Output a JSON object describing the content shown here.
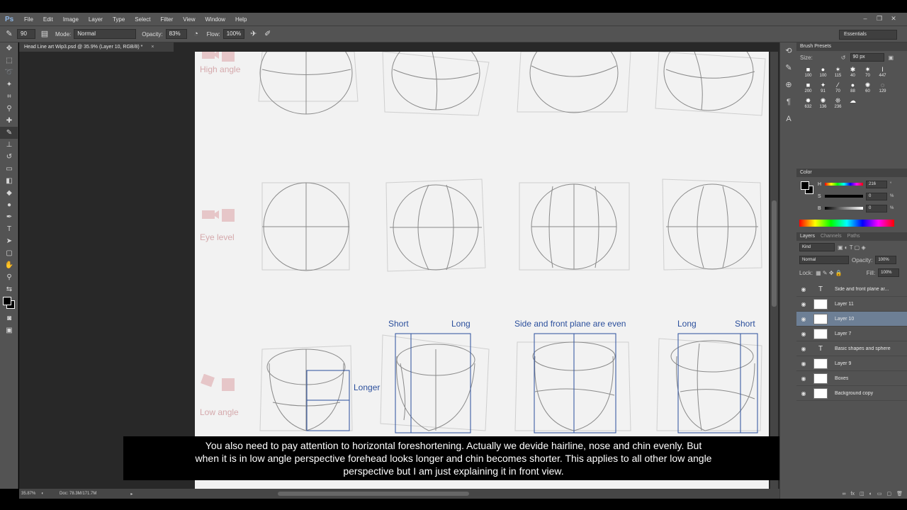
{
  "menubar": {
    "logo": "Ps",
    "items": [
      "File",
      "Edit",
      "Image",
      "Layer",
      "Type",
      "Select",
      "Filter",
      "View",
      "Window",
      "Help"
    ],
    "window_controls": [
      "–",
      "❐",
      "✕"
    ]
  },
  "options": {
    "brush_size": "90",
    "mode_label": "Mode:",
    "mode_value": "Normal",
    "opacity_label": "Opacity:",
    "opacity_value": "83%",
    "flow_label": "Flow:",
    "flow_value": "100%",
    "workspace": "Essentials"
  },
  "document": {
    "tab_title": "Head Line art Wip3.psd @ 35.9% (Layer 10, RGB/8) *",
    "close": "×"
  },
  "canvas": {
    "angles": {
      "high": "High angle",
      "eye": "Eye level",
      "low": "Low angle"
    },
    "annotations": {
      "short1": "Short",
      "long1": "Long",
      "even": "Side and front plane are even",
      "long2": "Long",
      "short2": "Short",
      "longer": "Longer"
    }
  },
  "caption": {
    "line1": "You also need to pay attention to horizontal foreshortening. Actually we devide hairline, nose and chin evenly. But",
    "line2": "when it is in low angle perspective forehead looks longer and chin becomes shorter. This applies to all other low angle",
    "line3": "perspective but I am just explaining it in front view."
  },
  "status": {
    "zoom": "35.87%",
    "doc": "Doc: 78.3M/171.7M"
  },
  "brush_panel": {
    "title": "Brush Presets",
    "size_label": "Size:",
    "size_value": "90 px",
    "presets": [
      "100",
      "100",
      "115",
      "40",
      "70",
      "447",
      "200",
      "91",
      "70",
      "88",
      "60",
      "129",
      "632",
      "136",
      "236",
      "",
      "",
      ""
    ]
  },
  "color_panel": {
    "title": "Color",
    "h_label": "H",
    "h_value": "216",
    "h_unit": "°",
    "s_label": "S",
    "s_value": "0",
    "s_unit": "%",
    "b_label": "B",
    "b_value": "0",
    "b_unit": "%"
  },
  "layers_panel": {
    "tabs": [
      "Layers",
      "Channels",
      "Paths"
    ],
    "kind_label": "Kind",
    "blend_mode": "Normal",
    "opacity_label": "Opacity:",
    "opacity_value": "100%",
    "lock_label": "Lock:",
    "fill_label": "Fill:",
    "fill_value": "100%",
    "layers": [
      {
        "name": "Side and front plane ar...",
        "type": "text"
      },
      {
        "name": "Layer 11",
        "type": "pixel"
      },
      {
        "name": "Layer 10",
        "type": "pixel",
        "selected": true
      },
      {
        "name": "Layer 7",
        "type": "pixel"
      },
      {
        "name": "Basic shapes and sphere",
        "type": "text"
      },
      {
        "name": "Layer 9",
        "type": "pixel"
      },
      {
        "name": "Boxes",
        "type": "pixel"
      },
      {
        "name": "Background copy",
        "type": "pixel"
      }
    ]
  },
  "colors": {
    "accent_blue": "#2b4f9c",
    "angle_label_pink": "#d5a9ac",
    "selected_layer": "#6d7f95"
  }
}
